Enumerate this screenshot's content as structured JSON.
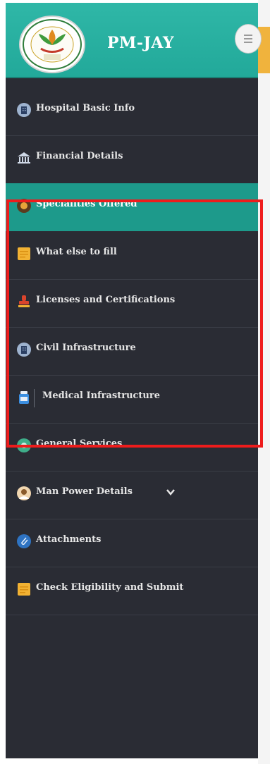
{
  "app": {
    "title": "PM-JAY"
  },
  "colors": {
    "header": "#2fb7a7",
    "sidebar": "#2a2c34",
    "active": "#1d9a8b",
    "highlight": "#ee1c1c"
  },
  "nav": {
    "items": [
      {
        "label": "Hospital Basic Info",
        "icon": "building-icon"
      },
      {
        "label": "Financial Details",
        "icon": "bank-icon"
      },
      {
        "label": "Specialities Offered",
        "icon": "specialities-icon",
        "active": true
      },
      {
        "label": "What else to fill",
        "icon": "notepad-icon"
      },
      {
        "label": "Licenses and Certifications",
        "icon": "stamp-icon"
      },
      {
        "label": "Civil Infrastructure",
        "icon": "building-icon"
      },
      {
        "label": "Medical Infrastructure",
        "icon": "medicine-bottle-icon"
      },
      {
        "label": "General Services",
        "icon": "services-icon"
      },
      {
        "label": "Man Power Details",
        "icon": "doctor-avatar-icon",
        "has_dropdown": true
      },
      {
        "label": "Attachments",
        "icon": "paperclip-icon"
      },
      {
        "label": "Check Eligibility and Submit",
        "icon": "notepad-icon"
      }
    ]
  }
}
